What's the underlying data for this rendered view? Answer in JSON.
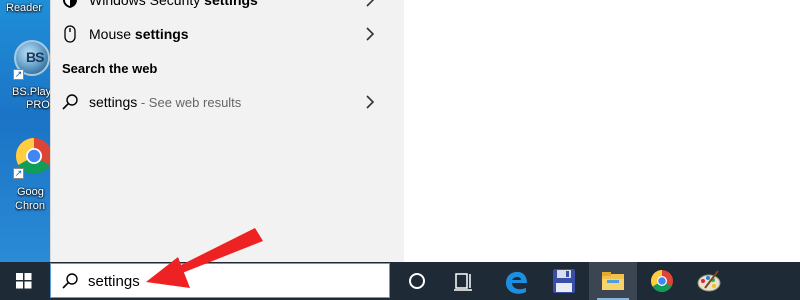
{
  "desktop": {
    "icons": [
      {
        "label_lines": [
          "Reader"
        ]
      },
      {
        "label_lines": [
          "BS.Play",
          "PRO"
        ],
        "logo_text": "BS"
      },
      {
        "label_lines": [
          "Goog",
          "Chron"
        ]
      }
    ]
  },
  "search_panel": {
    "items": [
      {
        "prefix": "Windows Security ",
        "bold": "settings",
        "icon": "shield-icon"
      },
      {
        "prefix": "Mouse ",
        "bold": "settings",
        "icon": "mouse-icon"
      }
    ],
    "section_header": "Search the web",
    "web_result": {
      "query": "settings",
      "suffix": " - See web results",
      "icon": "search-icon"
    }
  },
  "taskbar": {
    "search_value": "settings",
    "buttons": [
      "cortana-icon",
      "task-view-icon",
      "edge-icon",
      "save-disk-icon",
      "file-explorer-icon",
      "chrome-icon",
      "paint-icon"
    ]
  },
  "colors": {
    "taskbar": "#1e2a35",
    "panel": "#f2f2f2",
    "arrow": "#ee2222",
    "desktop": "#1f8fd8"
  }
}
